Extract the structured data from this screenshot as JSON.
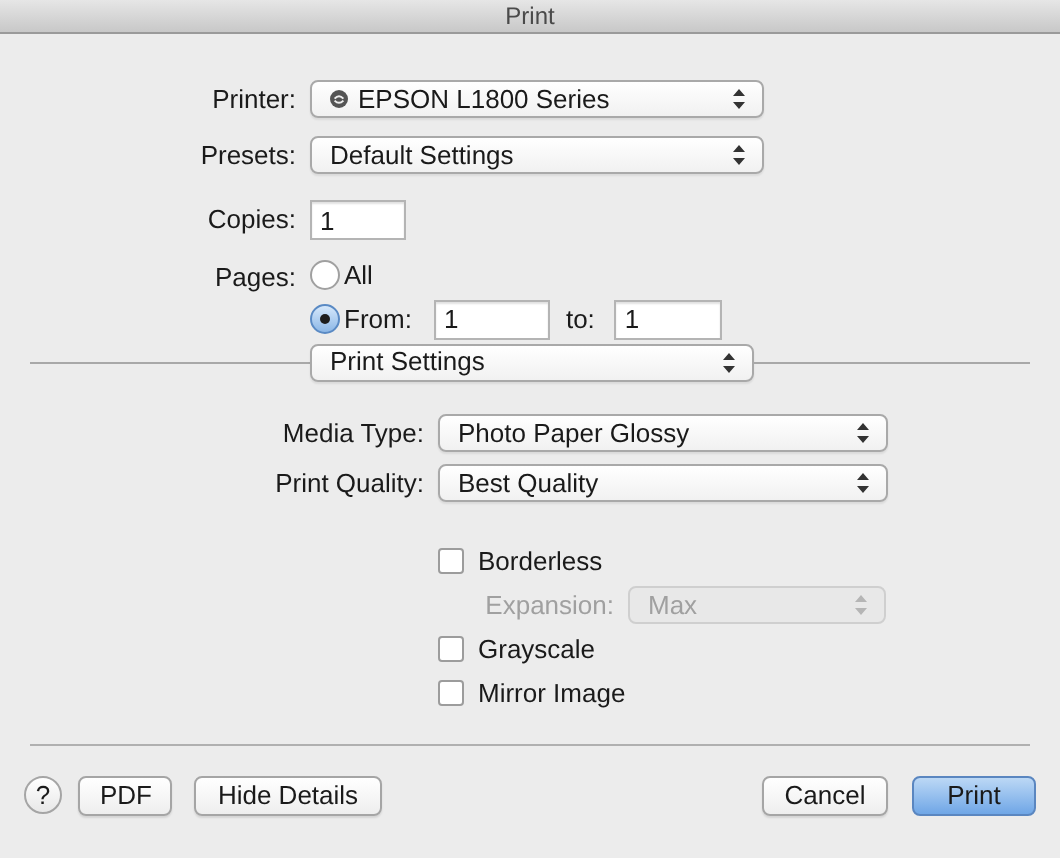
{
  "window": {
    "title": "Print"
  },
  "printer": {
    "label": "Printer:",
    "value": "EPSON L1800 Series"
  },
  "presets": {
    "label": "Presets:",
    "value": "Default Settings"
  },
  "copies": {
    "label": "Copies:",
    "value": "1"
  },
  "pages": {
    "label": "Pages:",
    "options": [
      {
        "label": "All",
        "selected": false
      },
      {
        "label": "From:",
        "selected": true
      }
    ],
    "from": "1",
    "to_label": "to:",
    "to": "1"
  },
  "section": {
    "value": "Print Settings"
  },
  "settings": [
    {
      "label": "Media Type:",
      "value": "Photo Paper Glossy"
    },
    {
      "label": "Print Quality:",
      "value": "Best Quality"
    }
  ],
  "options": [
    {
      "kind": "checkbox",
      "label": "Borderless",
      "checked": false
    },
    {
      "kind": "popup",
      "label": "Expansion:",
      "value": "Max",
      "disabled": true
    },
    {
      "kind": "checkbox",
      "label": "Grayscale",
      "checked": false
    },
    {
      "kind": "checkbox",
      "label": "Mirror Image",
      "checked": false
    }
  ],
  "buttons": {
    "help": "?",
    "pdf": "PDF",
    "details": "Hide Details",
    "cancel": "Cancel",
    "print": "Print"
  }
}
